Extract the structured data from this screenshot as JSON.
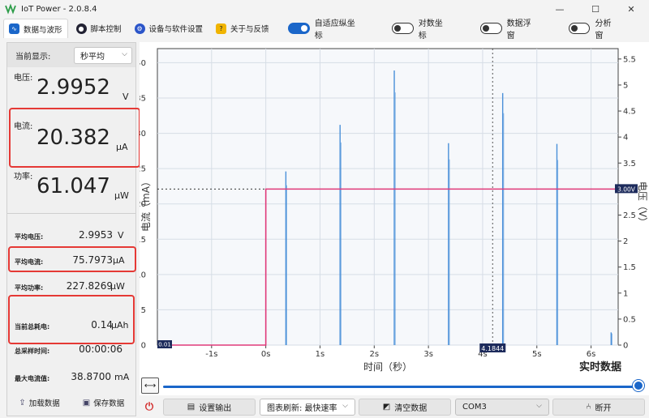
{
  "app": {
    "title": "IoT Power - 2.0.8.4"
  },
  "window_controls": {
    "minimize": "—",
    "maximize": "☐",
    "close": "✕"
  },
  "tabs": [
    {
      "label": "数据与波形",
      "icon": "waveform-icon",
      "active": true
    },
    {
      "label": "脚本控制",
      "icon": "script-icon",
      "active": false
    },
    {
      "label": "设备与软件设置",
      "icon": "settings-icon",
      "active": false
    },
    {
      "label": "关于与反馈",
      "icon": "help-icon",
      "active": false
    }
  ],
  "toggles": [
    {
      "label": "自适应纵坐标",
      "on": true
    },
    {
      "label": "对数坐标",
      "on": false
    },
    {
      "label": "数据浮窗",
      "on": false
    },
    {
      "label": "分析窗",
      "on": false
    }
  ],
  "left_panel": {
    "display_label": "当前显示:",
    "display_value": "秒平均",
    "voltage": {
      "label": "电压:",
      "value": "2.9952",
      "unit": "V"
    },
    "current": {
      "label": "电流:",
      "value": "20.382",
      "unit": "μA"
    },
    "power": {
      "label": "功率:",
      "value": "61.047",
      "unit": "μW"
    },
    "stats": [
      {
        "label": "平均电压:",
        "value": "2.9953",
        "unit": "V"
      },
      {
        "label": "平均电流:",
        "value": "75.7973",
        "unit": "μA"
      },
      {
        "label": "平均功率:",
        "value": "227.8269",
        "unit": "μW"
      },
      {
        "label": "当前总耗电:",
        "value": "0.14",
        "unit": "μAh"
      },
      {
        "label": "总采样时间:",
        "value": "00:00:06",
        "unit": ""
      },
      {
        "label": "最大电流值:",
        "value": "38.8700",
        "unit": "mA"
      }
    ],
    "load_button": "加载数据",
    "save_button": "保存数据"
  },
  "chart_data": {
    "type": "line",
    "xlabel": "时间（秒）",
    "ylabel_left": "电流（mA）",
    "ylabel_right": "电压（V）",
    "corner_label": "实时数据",
    "xlim": [
      -2,
      6.5
    ],
    "ylim_left": [
      0,
      42
    ],
    "ylim_right": [
      0,
      5.7
    ],
    "x_ticks": [
      "-1s",
      "0s",
      "1s",
      "2s",
      "3s",
      "4s",
      "5s",
      "6s"
    ],
    "x_tick_values": [
      -1,
      0,
      1,
      2,
      3,
      4,
      5,
      6
    ],
    "y_ticks_left": [
      0,
      5,
      10,
      15,
      20,
      25,
      30,
      35,
      40
    ],
    "y_ticks_right": [
      "0",
      "0.5",
      "1",
      "1.5",
      "2",
      "2.5",
      "3",
      "3.5",
      "4",
      "4.5",
      "5",
      "5.5"
    ],
    "y_tick_values_right": [
      0,
      0.5,
      1,
      1.5,
      2,
      2.5,
      3,
      3.5,
      4,
      4.5,
      5,
      5.5
    ],
    "grid": true,
    "series": [
      {
        "name": "电流",
        "color": "#4a90d9",
        "spikes": [
          {
            "x": 0.37,
            "y": 24.6
          },
          {
            "x": 1.37,
            "y": 31.2
          },
          {
            "x": 2.37,
            "y": 38.9
          },
          {
            "x": 3.37,
            "y": 28.6
          },
          {
            "x": 4.37,
            "y": 35.7
          },
          {
            "x": 5.37,
            "y": 28.5
          },
          {
            "x": 6.37,
            "y": 1.8
          }
        ]
      },
      {
        "name": "电压",
        "color": "#e03a7a",
        "points": [
          [
            -2,
            0
          ],
          [
            0,
            0
          ],
          [
            0,
            3.0
          ],
          [
            6.5,
            3.0
          ]
        ]
      }
    ],
    "cursor": {
      "x": 4.1844,
      "label": "4.1844"
    },
    "voltage_marker_label": "3.00V",
    "zero_marker_label": "0.01"
  },
  "bottom_bar": {
    "power_icon": "⏻",
    "output_button": "设置输出",
    "refresh_select": "图表刷新:  最快速率",
    "clear_button": "清空数据",
    "port_select": "COM3",
    "disconnect_button": "断开"
  }
}
